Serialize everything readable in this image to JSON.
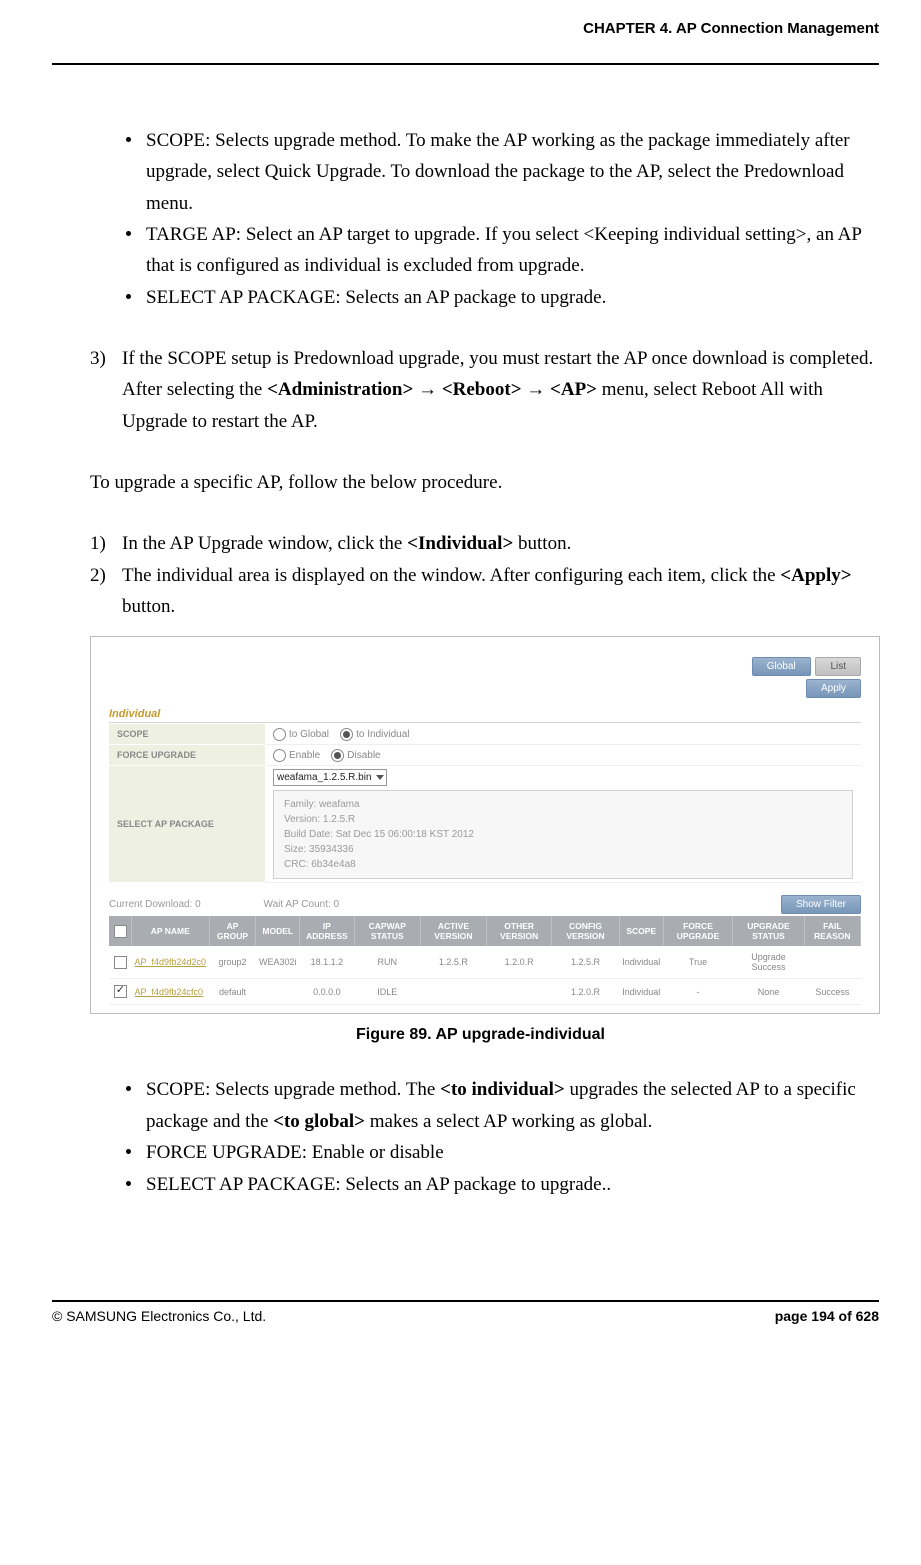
{
  "header": {
    "chapter": "CHAPTER 4. AP Connection Management"
  },
  "body": {
    "bullets1": {
      "b0": "SCOPE: Selects upgrade method. To make the AP working as the package immediately after upgrade, select Quick Upgrade. To download the package to the AP, select the Predownload menu.",
      "b1": "TARGE AP: Select an AP target to upgrade. If you select <Keeping individual setting>, an AP that is configured as individual is excluded from upgrade.",
      "b2": "SELECT AP PACKAGE: Selects an AP package to upgrade."
    },
    "step3": {
      "num": "3)",
      "pre": "If the SCOPE setup is Predownload upgrade, you must restart the AP once download is completed. After selecting the ",
      "s1": "<Administration>",
      "arrow": " → ",
      "s2": "<Reboot>",
      "s3": "<AP>",
      "post": " menu, select Reboot All with Upgrade to restart the AP."
    },
    "para": "To upgrade a specific AP, follow the below procedure.",
    "stepA": {
      "num": "1)",
      "pre": "In the AP Upgrade window, click the ",
      "s1": "<Individual>",
      "post": " button."
    },
    "stepB": {
      "num": "2)",
      "pre": "The individual area is displayed on the window. After configuring each item, click the ",
      "s1": "<Apply>",
      "post": " button."
    },
    "bullets2": {
      "b0pre": "SCOPE: Selects upgrade method. The ",
      "b0s1": "<to individual>",
      "b0mid": " upgrades the selected AP to a specific package and the ",
      "b0s2": "<to global>",
      "b0post": " makes a select AP working as global.",
      "b1": "FORCE UPGRADE: Enable or disable",
      "b2": "SELECT AP PACKAGE: Selects an AP package to upgrade.."
    }
  },
  "figure": {
    "caption": "Figure 89. AP upgrade-individual"
  },
  "shot": {
    "btn_global": "Global",
    "btn_list": "List",
    "btn_apply": "Apply",
    "section": "Individual",
    "rows": {
      "scope": "SCOPE",
      "force": "FORCE UPGRADE",
      "pkg": "SELECT AP PACKAGE"
    },
    "radio": {
      "to_global": "to Global",
      "to_individual": "to Individual",
      "enable": "Enable",
      "disable": "Disable"
    },
    "pkg_select": "weafama_1.2.5.R.bin",
    "info": {
      "l0": "Family: weafama",
      "l1": "Version: 1.2.5.R",
      "l2": "Build Date: Sat Dec 15 06:00:18 KST 2012",
      "l3": "Size: 35934336",
      "l4": "CRC: 6b34e4a8"
    },
    "counts": {
      "c0": "Current Download: 0",
      "c1": "Wait AP Count: 0"
    },
    "btn_filter": "Show Filter",
    "cols": {
      "c1": "AP NAME",
      "c2": "AP GROUP",
      "c3": "MODEL",
      "c4": "IP ADDRESS",
      "c5": "CAPWAP STATUS",
      "c6": "ACTIVE VERSION",
      "c7": "OTHER VERSION",
      "c8": "CONFIG VERSION",
      "c9": "SCOPE",
      "c10": "FORCE UPGRADE",
      "c11": "UPGRADE STATUS",
      "c12": "FAIL REASON"
    },
    "r1": {
      "name": "AP_f4d9fb24d2c0",
      "grp": "group2",
      "model": "WEA302i",
      "ip": "18.1.1.2",
      "cap": "RUN",
      "av": "1.2.5.R",
      "ov": "1.2.0.R",
      "cv": "1.2.5.R",
      "scope": "Individual",
      "fu": "True",
      "us": "Upgrade Success",
      "fr": ""
    },
    "r2": {
      "name": "AP_f4d9fb24cfc0",
      "grp": "default",
      "model": "",
      "ip": "0.0.0.0",
      "cap": "IDLE",
      "av": "",
      "ov": "",
      "cv": "1.2.0.R",
      "scope": "Individual",
      "fu": "-",
      "us": "None",
      "fr": "Success"
    }
  },
  "footer": {
    "left": "© SAMSUNG Electronics Co., Ltd.",
    "right": "page 194 of 628"
  }
}
